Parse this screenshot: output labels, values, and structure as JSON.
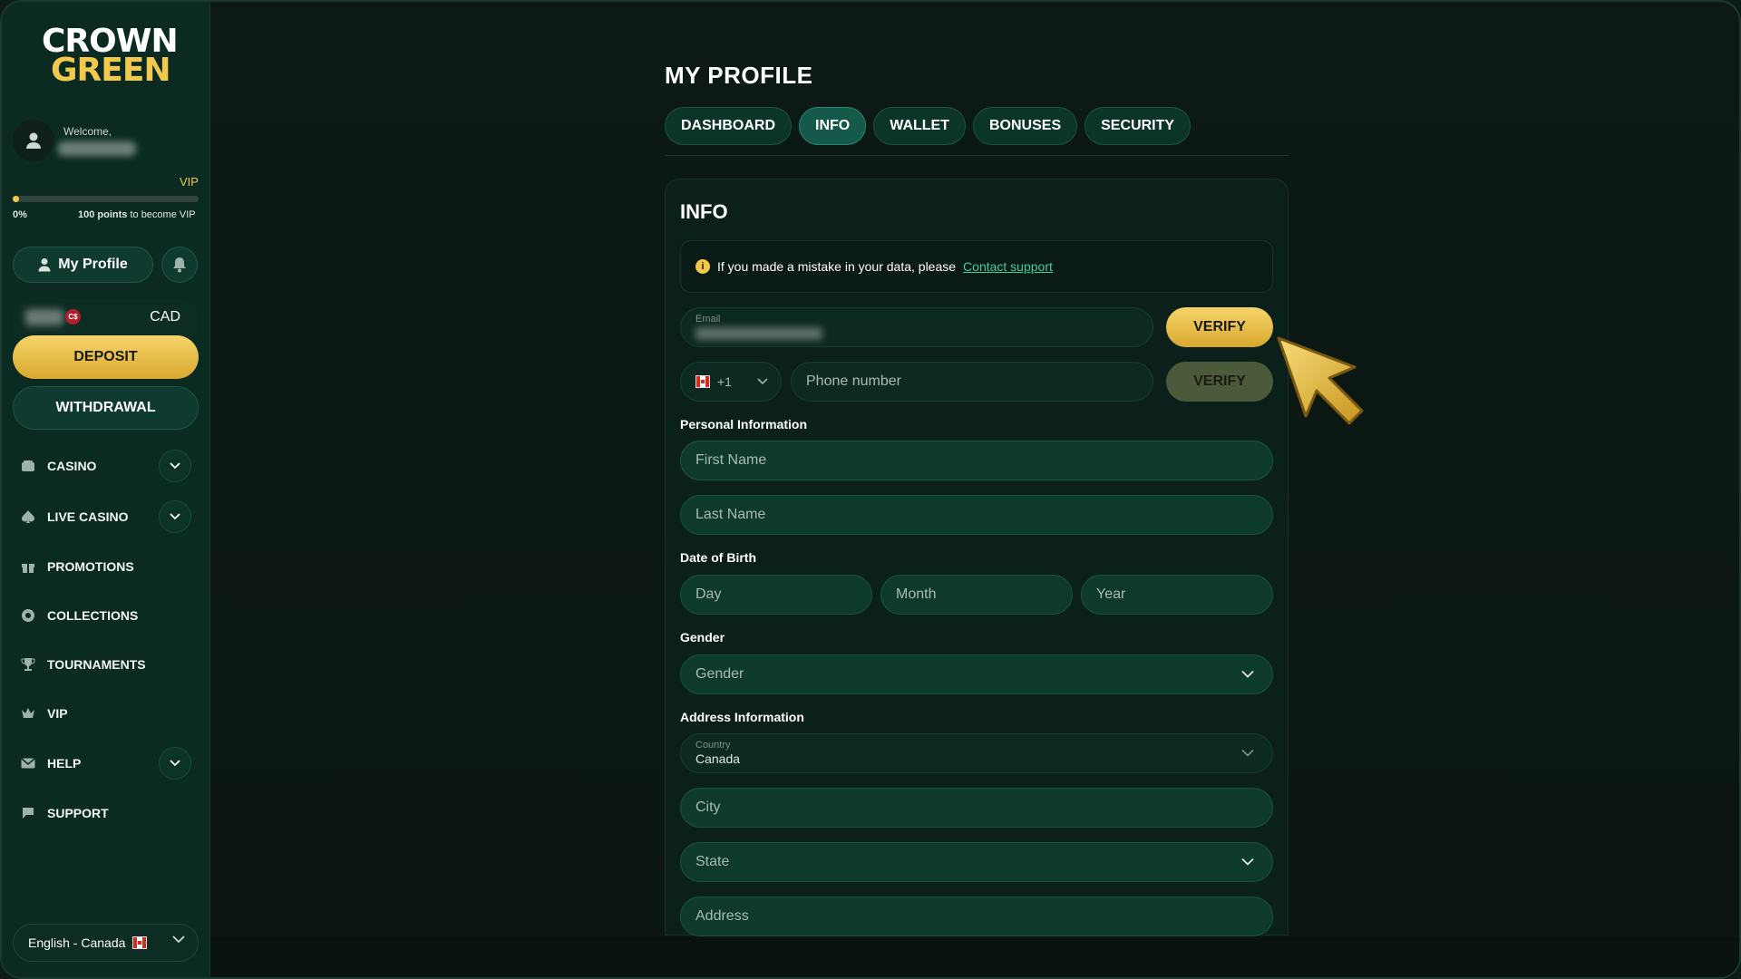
{
  "brand": {
    "line1": "CROWN",
    "line2": "GREEN"
  },
  "user": {
    "welcome": "Welcome,"
  },
  "vip": {
    "label": "VIP",
    "progress_percent": 0,
    "progress_text": "0%",
    "points_strong": "100 points",
    "points_rest": " to become VIP"
  },
  "sidebar": {
    "my_profile": "My Profile",
    "currency": "CAD",
    "currency_badge": "C$",
    "deposit": "DEPOSIT",
    "withdrawal": "WITHDRAWAL",
    "nav": [
      {
        "label": "CASINO",
        "icon": "casino-icon",
        "expandable": true
      },
      {
        "label": "LIVE CASINO",
        "icon": "spade-icon",
        "expandable": true
      },
      {
        "label": "PROMOTIONS",
        "icon": "gift-icon",
        "expandable": false
      },
      {
        "label": "COLLECTIONS",
        "icon": "collections-icon",
        "expandable": false
      },
      {
        "label": "TOURNAMENTS",
        "icon": "trophy-icon",
        "expandable": false
      },
      {
        "label": "VIP",
        "icon": "crown-icon",
        "expandable": false
      },
      {
        "label": "HELP",
        "icon": "mail-icon",
        "expandable": true
      },
      {
        "label": "SUPPORT",
        "icon": "chat-icon",
        "expandable": false
      }
    ],
    "language": "English - Canada"
  },
  "page": {
    "title": "MY PROFILE",
    "tabs": [
      "DASHBOARD",
      "INFO",
      "WALLET",
      "BONUSES",
      "SECURITY"
    ],
    "active_tab": "INFO"
  },
  "info": {
    "title": "INFO",
    "notice_text": "If you made a mistake in your data, please",
    "notice_link": "Contact support",
    "email_label": "Email",
    "verify": "VERIFY",
    "phone_code": "+1",
    "phone_placeholder": "Phone number",
    "personal_label": "Personal Information",
    "first_name": "First Name",
    "last_name": "Last Name",
    "dob_label": "Date of Birth",
    "day": "Day",
    "month": "Month",
    "year": "Year",
    "gender_label": "Gender",
    "gender_placeholder": "Gender",
    "address_label": "Address Information",
    "country_label": "Country",
    "country_value": "Canada",
    "city": "City",
    "state": "State",
    "address": "Address"
  },
  "colors": {
    "accent_gold": "#f2c94c",
    "bg": "#0d1a16",
    "sidebar": "#0a2a22",
    "link": "#3fcf9a"
  }
}
